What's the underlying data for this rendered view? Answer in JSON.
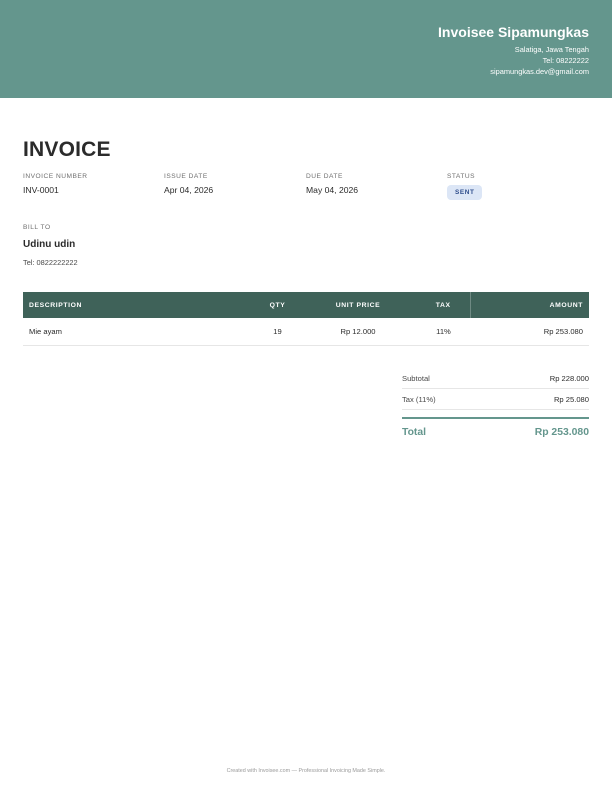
{
  "colors": {
    "header_bg": "#64968d",
    "table_header_bg": "#3f6259",
    "accent": "#64968d",
    "status_badge_bg": "#dce6f6",
    "status_badge_text": "#2e4d8c"
  },
  "company": {
    "name": "Invoisee Sipamungkas",
    "address": "Salatiga, Jawa Tengah",
    "tel": "Tel: 08222222",
    "email": "sipamungkas.dev@gmail.com"
  },
  "invoice": {
    "title": "INVOICE",
    "number_label": "INVOICE NUMBER",
    "number": "INV-0001",
    "issue_label": "ISSUE DATE",
    "issue_date": "Apr 04, 2026",
    "due_label": "DUE DATE",
    "due_date": "May 04, 2026",
    "status_label": "STATUS",
    "status": "SENT"
  },
  "bill_to": {
    "label": "BILL TO",
    "name": "Udinu udin",
    "tel": "Tel: 0822222222"
  },
  "items_table": {
    "headers": [
      "DESCRIPTION",
      "QTY",
      "UNIT PRICE",
      "TAX",
      "AMOUNT"
    ],
    "rows": [
      [
        "Mie ayam",
        "19",
        "Rp 12.000",
        "11%",
        "Rp 253.080"
      ]
    ]
  },
  "totals": {
    "subtotal_label": "Subtotal",
    "subtotal": "Rp 228.000",
    "tax_label": "Tax (11%)",
    "tax": "Rp 25.080",
    "total_label": "Total",
    "total": "Rp 253.080"
  },
  "footer": "Created with Invoisee.com — Professional Invoicing Made Simple."
}
